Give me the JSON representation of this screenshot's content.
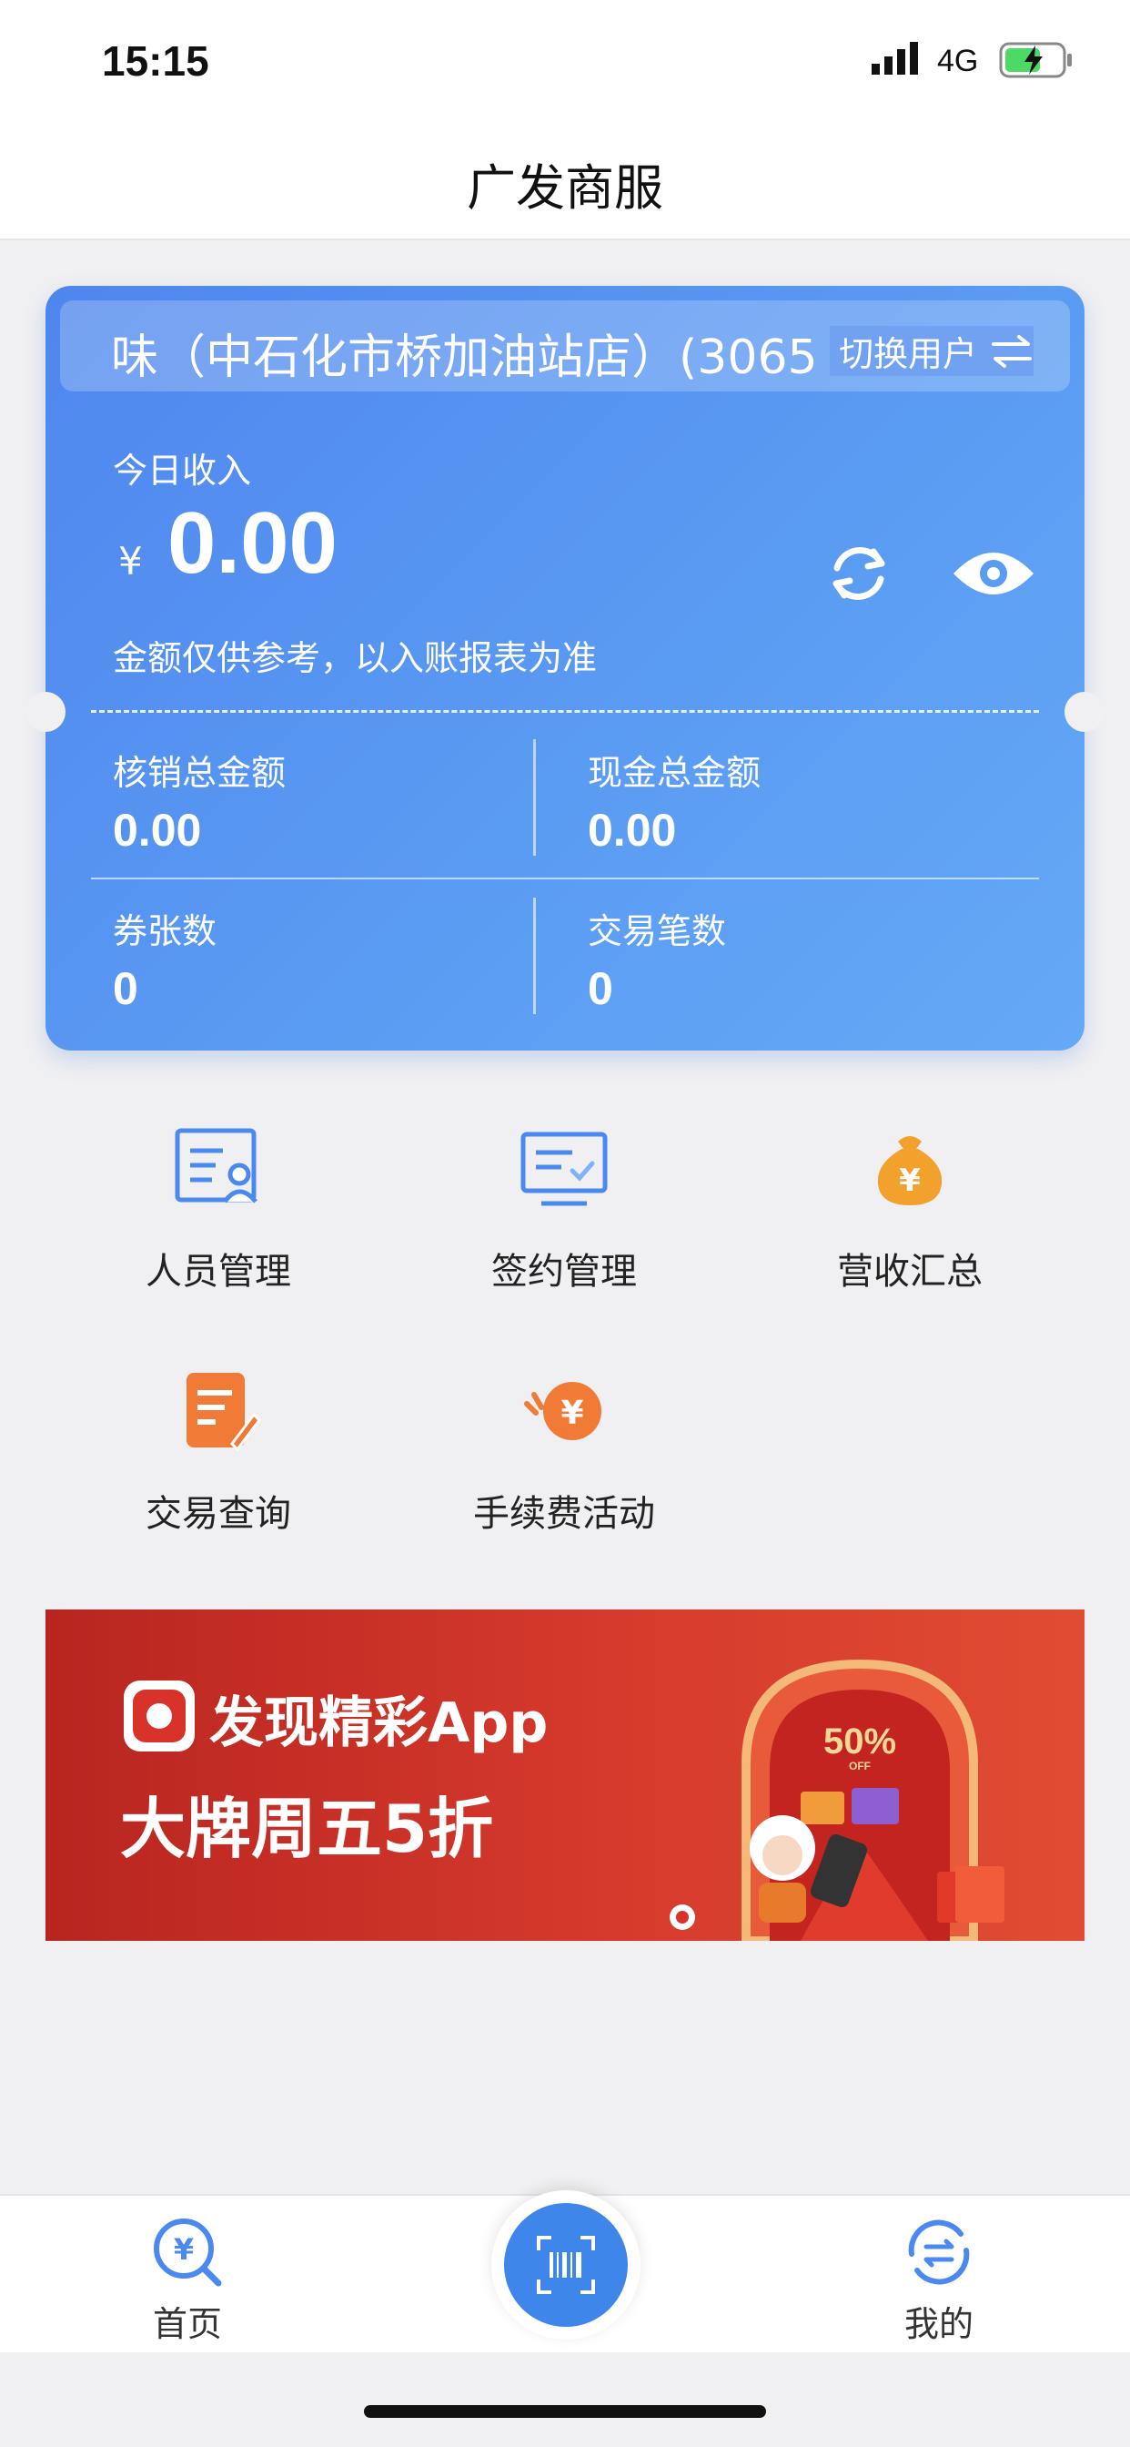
{
  "status_bar": {
    "time": "15:15",
    "network": "4G"
  },
  "nav": {
    "title": "广发商服"
  },
  "card": {
    "store_name": "味（中石化市桥加油站店）(3065",
    "switch_label": "切换用户",
    "today_label": "今日收入",
    "currency": "¥",
    "today_amount": "0.00",
    "note": "金额仅供参考，以入账报表为准",
    "stats": {
      "verify_total_label": "核销总金额",
      "verify_total_value": "0.00",
      "cash_total_label": "现金总金额",
      "cash_total_value": "0.00",
      "coupon_count_label": "券张数",
      "coupon_count_value": "0",
      "txn_count_label": "交易笔数",
      "txn_count_value": "0"
    }
  },
  "menu": {
    "staff": "人员管理",
    "contract": "签约管理",
    "revenue": "营收汇总",
    "txn_query": "交易查询",
    "fee_activity": "手续费活动"
  },
  "banner": {
    "line1": "发现精彩App",
    "line2": "大牌周五5折",
    "badge": "50%",
    "badge_sub": "OFF"
  },
  "tabs": {
    "home": "首页",
    "mine": "我的"
  },
  "colors": {
    "card_blue": "#4f86ee",
    "accent_orange": "#f08a2a",
    "banner_red": "#d63a2c"
  }
}
